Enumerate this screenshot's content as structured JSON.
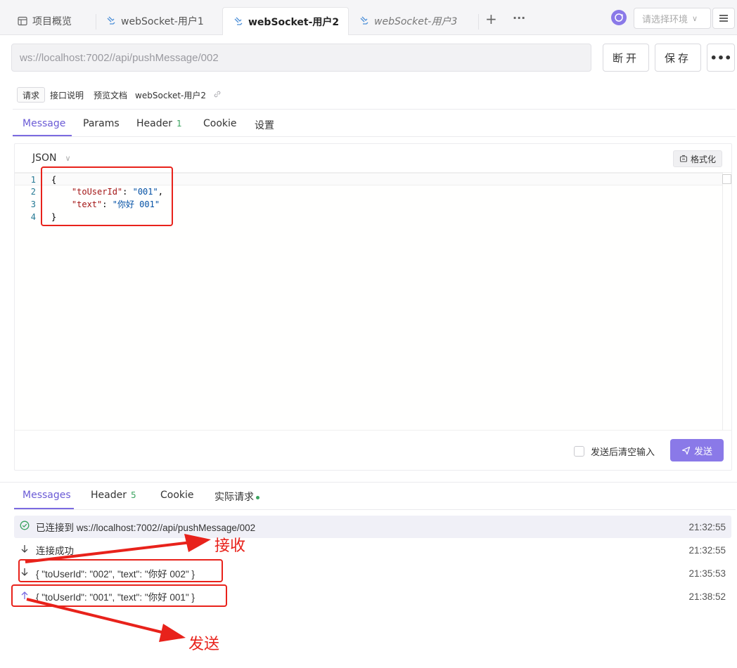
{
  "tabs": [
    {
      "label": "项目概览",
      "icon": "overview-icon"
    },
    {
      "label": "webSocket-用户1",
      "icon": "websocket-icon"
    },
    {
      "label": "webSocket-用户2",
      "icon": "websocket-icon"
    },
    {
      "label": "webSocket-用户3",
      "icon": "websocket-icon"
    }
  ],
  "toolbar": {
    "add_label": "+",
    "more_label": "···",
    "env_placeholder": "请选择环境",
    "env_icon": "env-sync-icon"
  },
  "request": {
    "url": "ws://localhost:7002//api/pushMessage/002",
    "disconnect_label": "断开",
    "save_label": "保存",
    "more_label": "•••"
  },
  "subtabs": {
    "items": [
      "请求",
      "接口说明",
      "预览文档"
    ],
    "api_name": "webSocket-用户2"
  },
  "request_tabs": {
    "message": "Message",
    "params": "Params",
    "header": "Header",
    "header_count": "1",
    "cookie": "Cookie",
    "settings": "设置"
  },
  "editor": {
    "format_type": "JSON",
    "format_button": "格式化",
    "line_numbers": [
      "1",
      "2",
      "3",
      "4"
    ],
    "line1": "{",
    "line2_key": "\"toUserId\"",
    "line2_val": "\"001\"",
    "line3_key": "\"text\"",
    "line3_val": "\"你好 001\"",
    "line4": "}",
    "clear_after_send": "发送后清空输入",
    "send_label": "发送"
  },
  "response_tabs": {
    "messages": "Messages",
    "header": "Header",
    "header_count": "5",
    "cookie": "Cookie",
    "actual_request": "实际请求"
  },
  "messages": [
    {
      "direction": "connected",
      "text": "已连接到 ws://localhost:7002//api/pushMessage/002",
      "time": "21:32:55"
    },
    {
      "direction": "received",
      "text": "连接成功",
      "time": "21:32:55"
    },
    {
      "direction": "received",
      "text": "{ \"toUserId\": \"002\", \"text\": \"你好 002\" }",
      "time": "21:35:53"
    },
    {
      "direction": "sent",
      "text": "{ \"toUserId\": \"001\", \"text\": \"你好 001\" }",
      "time": "21:38:52"
    }
  ],
  "annotations": {
    "receive_label": "接收",
    "send_label": "发送",
    "color": "#e8221b"
  },
  "colors": {
    "accent": "#7b6be0",
    "send_button": "#8a79e8",
    "badge_green": "#3aa35f"
  }
}
